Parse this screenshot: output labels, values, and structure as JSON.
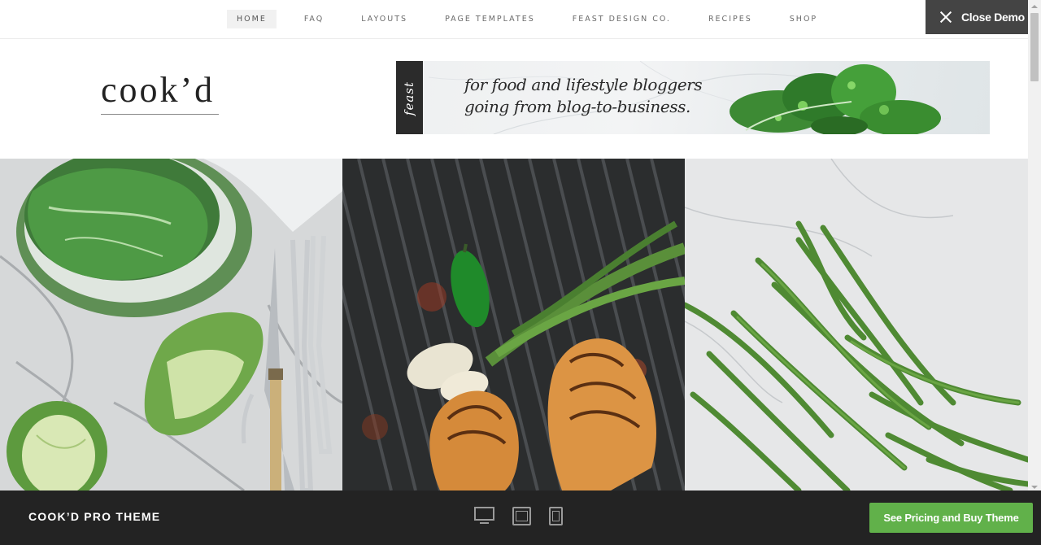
{
  "nav": {
    "items": [
      {
        "label": "HOME",
        "active": true
      },
      {
        "label": "FAQ"
      },
      {
        "label": "LAYOUTS"
      },
      {
        "label": "PAGE TEMPLATES"
      },
      {
        "label": "FEAST DESIGN CO."
      },
      {
        "label": "RECIPES"
      },
      {
        "label": "SHOP"
      }
    ]
  },
  "close_demo": {
    "label": "Close Demo",
    "icon": "close-icon"
  },
  "header": {
    "logo": "cook’d",
    "banner": {
      "tab_text": "feast",
      "line1": "for food and lifestyle bloggers",
      "line2": "going from blog-to-business."
    }
  },
  "photos": [
    {
      "subject": "savoy cabbage with knife and forks on marble"
    },
    {
      "subject": "grilled chicken and green onions on grill"
    },
    {
      "subject": "green beans on marble"
    }
  ],
  "bottom_bar": {
    "theme_name": "COOK’D PRO THEME",
    "devices": [
      "desktop-icon",
      "tablet-icon",
      "phone-icon"
    ],
    "buy_label": "See Pricing and Buy Theme"
  },
  "colors": {
    "accent_green": "#61b14a",
    "bar_dark": "#232323",
    "close_bg": "#444444"
  }
}
